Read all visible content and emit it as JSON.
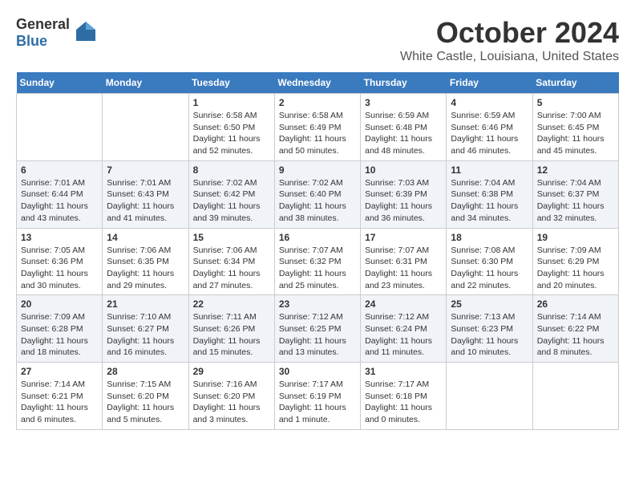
{
  "logo": {
    "general": "General",
    "blue": "Blue"
  },
  "title": "October 2024",
  "location": "White Castle, Louisiana, United States",
  "days_of_week": [
    "Sunday",
    "Monday",
    "Tuesday",
    "Wednesday",
    "Thursday",
    "Friday",
    "Saturday"
  ],
  "weeks": [
    [
      {
        "day": "",
        "info": ""
      },
      {
        "day": "",
        "info": ""
      },
      {
        "day": "1",
        "info": "Sunrise: 6:58 AM\nSunset: 6:50 PM\nDaylight: 11 hours and 52 minutes."
      },
      {
        "day": "2",
        "info": "Sunrise: 6:58 AM\nSunset: 6:49 PM\nDaylight: 11 hours and 50 minutes."
      },
      {
        "day": "3",
        "info": "Sunrise: 6:59 AM\nSunset: 6:48 PM\nDaylight: 11 hours and 48 minutes."
      },
      {
        "day": "4",
        "info": "Sunrise: 6:59 AM\nSunset: 6:46 PM\nDaylight: 11 hours and 46 minutes."
      },
      {
        "day": "5",
        "info": "Sunrise: 7:00 AM\nSunset: 6:45 PM\nDaylight: 11 hours and 45 minutes."
      }
    ],
    [
      {
        "day": "6",
        "info": "Sunrise: 7:01 AM\nSunset: 6:44 PM\nDaylight: 11 hours and 43 minutes."
      },
      {
        "day": "7",
        "info": "Sunrise: 7:01 AM\nSunset: 6:43 PM\nDaylight: 11 hours and 41 minutes."
      },
      {
        "day": "8",
        "info": "Sunrise: 7:02 AM\nSunset: 6:42 PM\nDaylight: 11 hours and 39 minutes."
      },
      {
        "day": "9",
        "info": "Sunrise: 7:02 AM\nSunset: 6:40 PM\nDaylight: 11 hours and 38 minutes."
      },
      {
        "day": "10",
        "info": "Sunrise: 7:03 AM\nSunset: 6:39 PM\nDaylight: 11 hours and 36 minutes."
      },
      {
        "day": "11",
        "info": "Sunrise: 7:04 AM\nSunset: 6:38 PM\nDaylight: 11 hours and 34 minutes."
      },
      {
        "day": "12",
        "info": "Sunrise: 7:04 AM\nSunset: 6:37 PM\nDaylight: 11 hours and 32 minutes."
      }
    ],
    [
      {
        "day": "13",
        "info": "Sunrise: 7:05 AM\nSunset: 6:36 PM\nDaylight: 11 hours and 30 minutes."
      },
      {
        "day": "14",
        "info": "Sunrise: 7:06 AM\nSunset: 6:35 PM\nDaylight: 11 hours and 29 minutes."
      },
      {
        "day": "15",
        "info": "Sunrise: 7:06 AM\nSunset: 6:34 PM\nDaylight: 11 hours and 27 minutes."
      },
      {
        "day": "16",
        "info": "Sunrise: 7:07 AM\nSunset: 6:32 PM\nDaylight: 11 hours and 25 minutes."
      },
      {
        "day": "17",
        "info": "Sunrise: 7:07 AM\nSunset: 6:31 PM\nDaylight: 11 hours and 23 minutes."
      },
      {
        "day": "18",
        "info": "Sunrise: 7:08 AM\nSunset: 6:30 PM\nDaylight: 11 hours and 22 minutes."
      },
      {
        "day": "19",
        "info": "Sunrise: 7:09 AM\nSunset: 6:29 PM\nDaylight: 11 hours and 20 minutes."
      }
    ],
    [
      {
        "day": "20",
        "info": "Sunrise: 7:09 AM\nSunset: 6:28 PM\nDaylight: 11 hours and 18 minutes."
      },
      {
        "day": "21",
        "info": "Sunrise: 7:10 AM\nSunset: 6:27 PM\nDaylight: 11 hours and 16 minutes."
      },
      {
        "day": "22",
        "info": "Sunrise: 7:11 AM\nSunset: 6:26 PM\nDaylight: 11 hours and 15 minutes."
      },
      {
        "day": "23",
        "info": "Sunrise: 7:12 AM\nSunset: 6:25 PM\nDaylight: 11 hours and 13 minutes."
      },
      {
        "day": "24",
        "info": "Sunrise: 7:12 AM\nSunset: 6:24 PM\nDaylight: 11 hours and 11 minutes."
      },
      {
        "day": "25",
        "info": "Sunrise: 7:13 AM\nSunset: 6:23 PM\nDaylight: 11 hours and 10 minutes."
      },
      {
        "day": "26",
        "info": "Sunrise: 7:14 AM\nSunset: 6:22 PM\nDaylight: 11 hours and 8 minutes."
      }
    ],
    [
      {
        "day": "27",
        "info": "Sunrise: 7:14 AM\nSunset: 6:21 PM\nDaylight: 11 hours and 6 minutes."
      },
      {
        "day": "28",
        "info": "Sunrise: 7:15 AM\nSunset: 6:20 PM\nDaylight: 11 hours and 5 minutes."
      },
      {
        "day": "29",
        "info": "Sunrise: 7:16 AM\nSunset: 6:20 PM\nDaylight: 11 hours and 3 minutes."
      },
      {
        "day": "30",
        "info": "Sunrise: 7:17 AM\nSunset: 6:19 PM\nDaylight: 11 hours and 1 minute."
      },
      {
        "day": "31",
        "info": "Sunrise: 7:17 AM\nSunset: 6:18 PM\nDaylight: 11 hours and 0 minutes."
      },
      {
        "day": "",
        "info": ""
      },
      {
        "day": "",
        "info": ""
      }
    ]
  ]
}
